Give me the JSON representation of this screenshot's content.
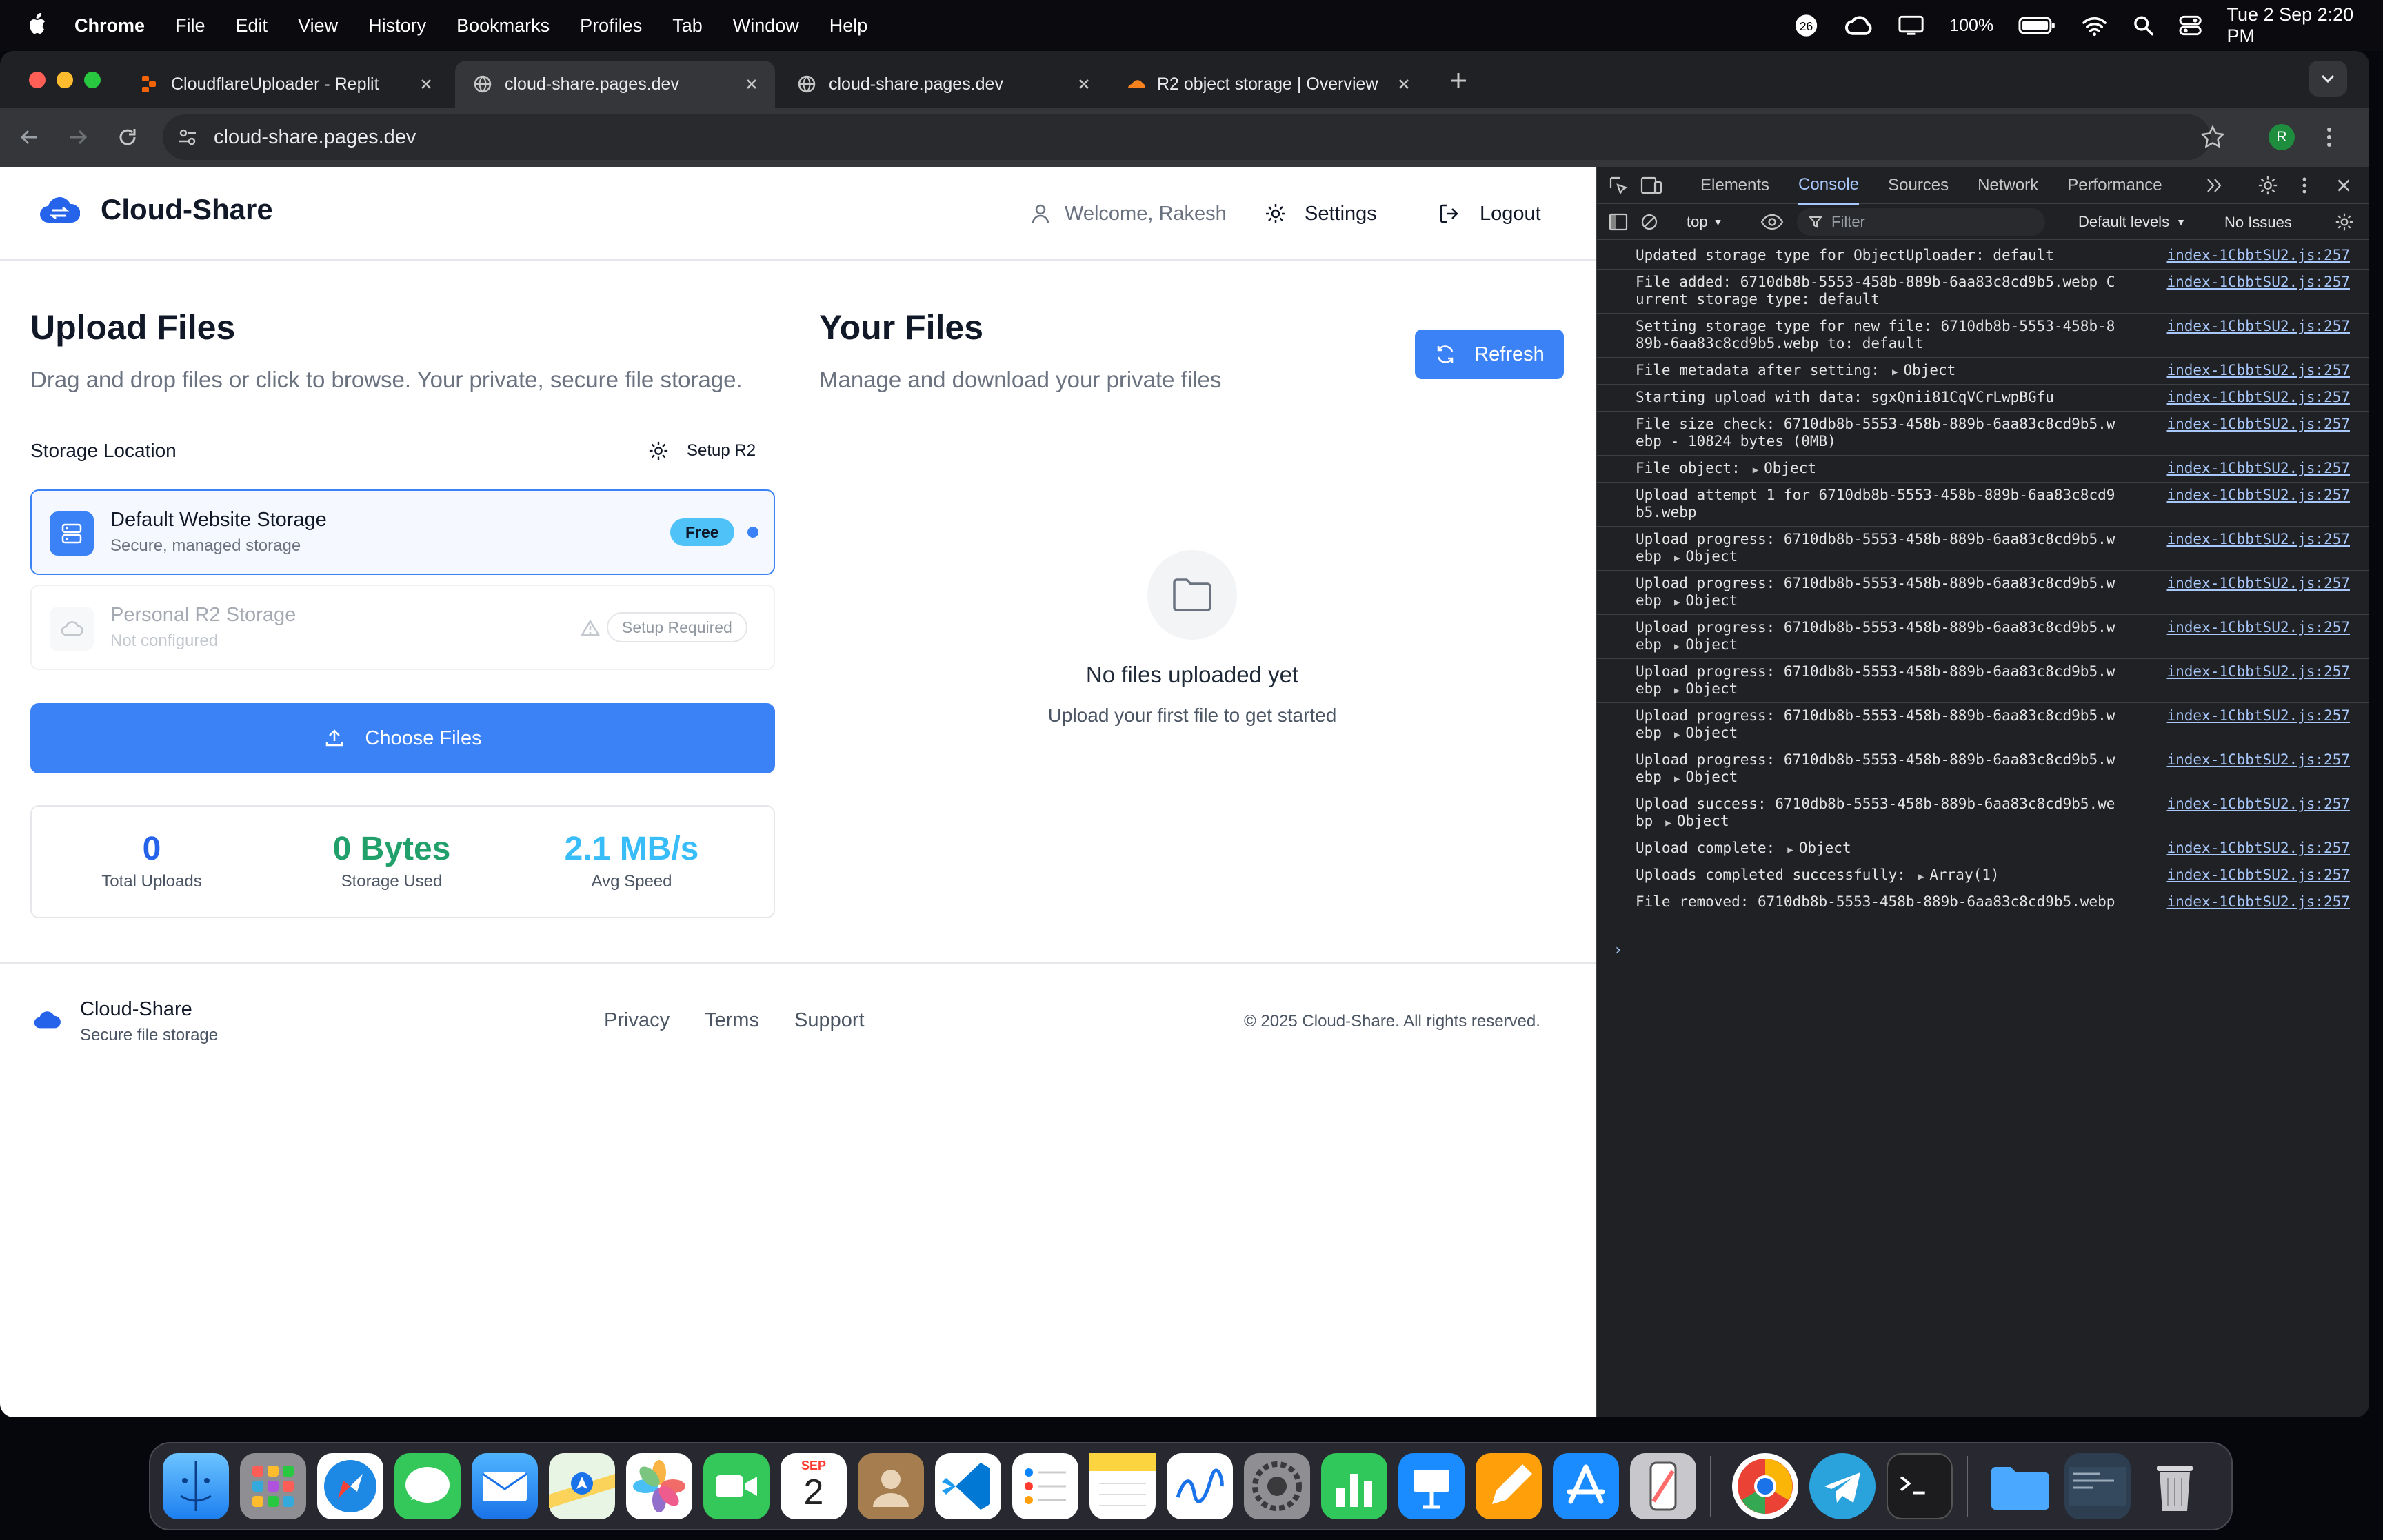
{
  "menubar": {
    "items": [
      "Chrome",
      "File",
      "Edit",
      "View",
      "History",
      "Bookmarks",
      "Profiles",
      "Tab",
      "Window",
      "Help"
    ],
    "battery": "100%",
    "datetime": "Tue 2 Sep  2:20 PM"
  },
  "tabs": [
    {
      "title": "CloudflareUploader - Replit"
    },
    {
      "title": "cloud-share.pages.dev"
    },
    {
      "title": "cloud-share.pages.dev"
    },
    {
      "title": "R2 object storage | Overview"
    }
  ],
  "toolbar": {
    "url": "cloud-share.pages.dev",
    "profile_initial": "R"
  },
  "app": {
    "brand": "Cloud-Share",
    "welcome": "Welcome, Rakesh",
    "settings": "Settings",
    "logout": "Logout",
    "upload": {
      "title": "Upload Files",
      "subtitle": "Drag and drop files or click to browse. Your private, secure file storage.",
      "storage_label": "Storage Location",
      "setup_r2": "Setup R2",
      "option_default": {
        "title": "Default Website Storage",
        "subtitle": "Secure, managed storage",
        "badge": "Free"
      },
      "option_r2": {
        "title": "Personal R2 Storage",
        "subtitle": "Not configured",
        "badge": "Setup Required"
      },
      "choose": "Choose Files",
      "stats": [
        {
          "value": "0",
          "label": "Total Uploads",
          "color": "#2563eb"
        },
        {
          "value": "0 Bytes",
          "label": "Storage Used",
          "color": "#22a06b"
        },
        {
          "value": "2.1 MB/s",
          "label": "Avg Speed",
          "color": "#38bdf8"
        }
      ]
    },
    "files": {
      "title": "Your Files",
      "subtitle": "Manage and download your private files",
      "refresh": "Refresh",
      "empty_title": "No files uploaded yet",
      "empty_sub": "Upload your first file to get started"
    },
    "footer": {
      "brand": "Cloud-Share",
      "tagline": "Secure file storage",
      "links": [
        "Privacy",
        "Terms",
        "Support"
      ],
      "copyright": "© 2025 Cloud-Share. All rights reserved."
    }
  },
  "devtools": {
    "tabs": [
      "Elements",
      "Console",
      "Sources",
      "Network",
      "Performance"
    ],
    "context": "top",
    "filter_placeholder": "Filter",
    "levels": "Default levels",
    "issues": "No Issues",
    "source": "index-1CbbtSU2.js:257",
    "logs": [
      {
        "msg": "Updated storage type for ObjectUploader: default"
      },
      {
        "msg": "File added: 6710db8b-5553-458b-889b-6aa83c8cd9b5.webp Current storage type: default"
      },
      {
        "msg": "Setting storage type for new file: 6710db8b-5553-458b-889b-6aa83c8cd9b5.webp to: default"
      },
      {
        "msg": "File metadata after setting:",
        "obj": "Object"
      },
      {
        "msg": "Starting upload with data: sgxQnii81CqVCrLwpBGfu"
      },
      {
        "msg": "File size check: 6710db8b-5553-458b-889b-6aa83c8cd9b5.webp - 10824 bytes (0MB)"
      },
      {
        "msg": "File object:",
        "obj": "Object"
      },
      {
        "msg": "Upload attempt 1 for 6710db8b-5553-458b-889b-6aa83c8cd9b5.webp"
      },
      {
        "msg": "Upload progress: 6710db8b-5553-458b-889b-6aa83c8cd9b5.webp",
        "obj": "Object"
      },
      {
        "msg": "Upload progress: 6710db8b-5553-458b-889b-6aa83c8cd9b5.webp",
        "obj": "Object"
      },
      {
        "msg": "Upload progress: 6710db8b-5553-458b-889b-6aa83c8cd9b5.webp",
        "obj": "Object"
      },
      {
        "msg": "Upload progress: 6710db8b-5553-458b-889b-6aa83c8cd9b5.webp",
        "obj": "Object"
      },
      {
        "msg": "Upload progress: 6710db8b-5553-458b-889b-6aa83c8cd9b5.webp",
        "obj": "Object"
      },
      {
        "msg": "Upload progress: 6710db8b-5553-458b-889b-6aa83c8cd9b5.webp",
        "obj": "Object"
      },
      {
        "msg": "Upload success: 6710db8b-5553-458b-889b-6aa83c8cd9b5.webp",
        "obj": "Object"
      },
      {
        "msg": "Upload complete:",
        "obj": "Object"
      },
      {
        "msg": "Uploads completed successfully:",
        "obj": "Array(1)"
      },
      {
        "msg": "File removed: 6710db8b-5553-458b-889b-6aa83c8cd9b5.webp"
      }
    ]
  },
  "dock": {
    "calendar_month": "SEP",
    "calendar_day": "2",
    "apps": [
      "finder-icon",
      "launchpad-icon",
      "safari-icon",
      "messages-icon",
      "mail-icon",
      "maps-icon",
      "photos-icon",
      "facetime-icon",
      "calendar-icon",
      "contacts-icon",
      "vscode-icon",
      "reminders-icon",
      "notes-icon",
      "freeform-icon",
      "system-settings-icon",
      "numbers-icon",
      "keynote-icon",
      "pages-icon",
      "app-store-icon",
      "iphone-mirroring-icon",
      "chrome-icon",
      "telegram-icon",
      "terminal-icon",
      "downloads-folder-icon",
      "screen-preview-icon",
      "trash-icon"
    ]
  }
}
